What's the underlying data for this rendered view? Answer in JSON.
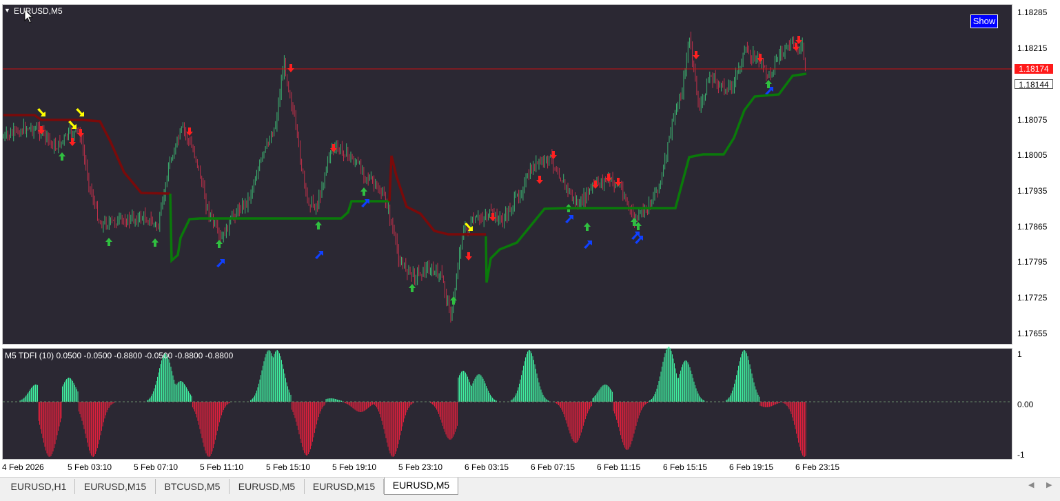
{
  "window": {
    "title": "EURUSD,M5"
  },
  "show_button": {
    "label": "Show"
  },
  "price_axis": {
    "ticks": [
      "1.18285",
      "1.18215",
      "1.18075",
      "1.18005",
      "1.17935",
      "1.17865",
      "1.17795",
      "1.17725",
      "1.17655"
    ],
    "current_price": "1.18174",
    "marker_price": "1.18144"
  },
  "indicator": {
    "label": "M5 TDFI (10) 0.0500 -0.0500 -0.8800 -0.0500 -0.8800 -0.8800",
    "axis": [
      "1",
      "0.00",
      "-1"
    ]
  },
  "time_axis": [
    "4 Feb 2026",
    "5 Feb 03:10",
    "5 Feb 07:10",
    "5 Feb 11:10",
    "5 Feb 15:10",
    "5 Feb 19:10",
    "5 Feb 23:10",
    "6 Feb 03:15",
    "6 Feb 07:15",
    "6 Feb 11:15",
    "6 Feb 15:15",
    "6 Feb 19:15",
    "6 Feb 23:15"
  ],
  "tabs": [
    {
      "label": "EURUSD,H1",
      "active": false
    },
    {
      "label": "EURUSD,M15",
      "active": false
    },
    {
      "label": "BTCUSD,M5",
      "active": false
    },
    {
      "label": "EURUSD,M5",
      "active": false
    },
    {
      "label": "EURUSD,M15",
      "active": false
    },
    {
      "label": "EURUSD,M5",
      "active": true
    }
  ],
  "colors": {
    "background": "#2b2833",
    "bull_candle": "#3cb371",
    "bear_candle": "#c0304a",
    "trail_up": "#0a7a0a",
    "trail_down": "#7a0a0a",
    "ind_pos": "#3ff0a0",
    "ind_neg": "#e0203c",
    "arrow_yellow": "#ffff00",
    "arrow_blue": "#1040ff",
    "arrow_green": "#30c040",
    "arrow_red": "#ff2020",
    "current_price_line": "#cc1010"
  },
  "icons": [
    "dropdown-triangle-icon",
    "cursor-icon",
    "scroll-left-icon",
    "scroll-right-icon"
  ]
}
